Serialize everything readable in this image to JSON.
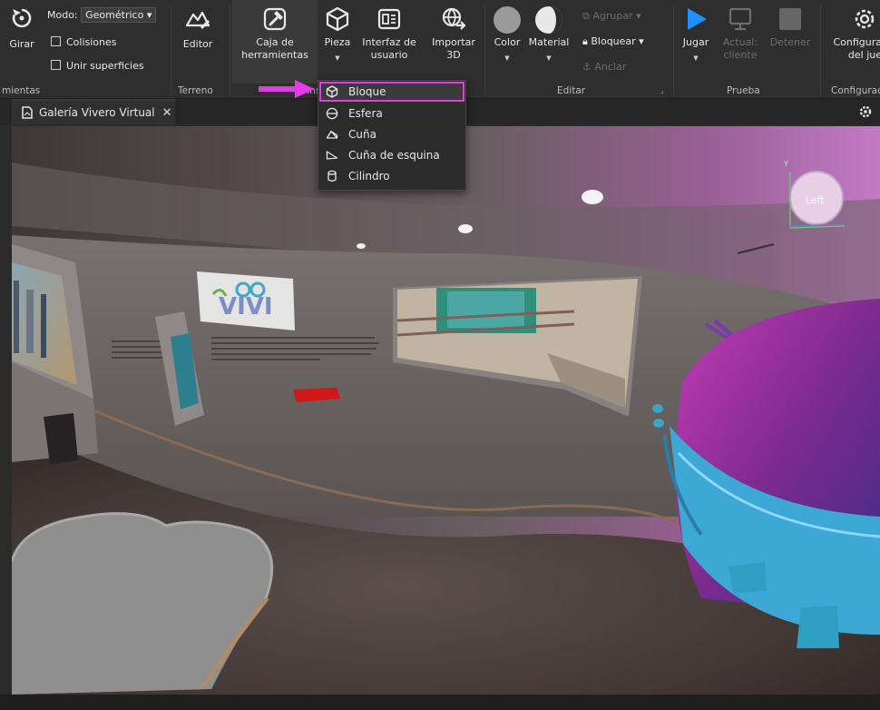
{
  "ribbon": {
    "groups": {
      "tools_label": "mientas",
      "terrain_label": "Terreno",
      "insert_label_prefix": "Ins",
      "insert_label_suffix": "o",
      "edit_label": "Editar",
      "test_label": "Prueba",
      "settings_label": "Configurac"
    },
    "rotate_label": "Girar",
    "mode_label": "Modo:",
    "mode_value": "Geométrico",
    "collisions_label": "Colisiones",
    "join_surfaces_label": "Unir superficies",
    "editor_label": "Editor",
    "toolbox_label_1": "Caja de",
    "toolbox_label_2": "herramientas",
    "part_label": "Pieza",
    "ui_label_1": "Interfaz de",
    "ui_label_2": "usuario",
    "import_label_1": "Importar",
    "import_label_2": "3D",
    "color_label": "Color",
    "material_label": "Material",
    "group_label": "Agrupar",
    "lock_label": "Bloquear",
    "anchor_label": "Anclar",
    "play_label": "Jugar",
    "current_label_1": "Actual:",
    "current_label_2": "cliente",
    "stop_label": "Detener",
    "settings_label_1": "Configura",
    "settings_label_2": "del jue"
  },
  "tab": {
    "title": "Galería Vivero Virtual",
    "close": "✕"
  },
  "part_menu": {
    "items": [
      {
        "label": "Bloque",
        "icon": "cube-icon"
      },
      {
        "label": "Esfera",
        "icon": "sphere-icon"
      },
      {
        "label": "Cuña",
        "icon": "wedge-icon"
      },
      {
        "label": "Cuña de esquina",
        "icon": "corner-wedge-icon"
      },
      {
        "label": "Cilindro",
        "icon": "cylinder-icon"
      }
    ]
  },
  "viewport": {
    "sign_text": "VIVI",
    "view_cube_label": "Left",
    "axis_y": "Y"
  },
  "colors": {
    "accent": "#e43ae8",
    "play": "#1e90ff"
  }
}
